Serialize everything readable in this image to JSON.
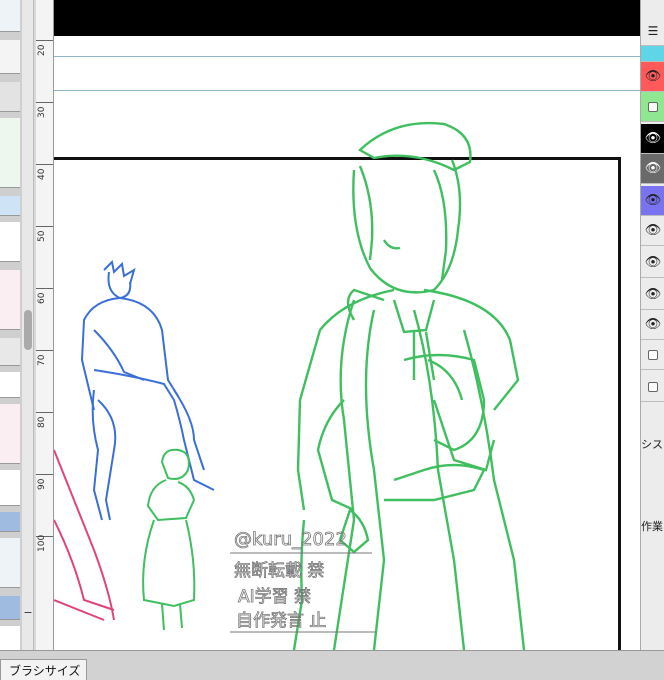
{
  "ruler": {
    "ticks": [
      "20",
      "30",
      "40",
      "50",
      "60",
      "70",
      "80",
      "90",
      "100"
    ]
  },
  "canvas": {
    "watermark_lines": [
      "@kuru_2022",
      "無断転載 禁",
      "AI学習 禁",
      "自作発言 止"
    ]
  },
  "layers_panel": {
    "rows": [
      {
        "type": "icon",
        "icon": "layer-list-icon",
        "color": "#ececec"
      },
      {
        "type": "empty",
        "color": "#5fd6e8"
      },
      {
        "type": "eye",
        "icon": "eye-icon",
        "color": "#ff5a5a"
      },
      {
        "type": "check",
        "icon": "checkbox",
        "color": "#8fe88f"
      },
      {
        "type": "eye",
        "icon": "eye-icon",
        "color": "#000000"
      },
      {
        "type": "eye",
        "icon": "eye-icon",
        "color": "#6a6a6a"
      },
      {
        "type": "eye",
        "icon": "eye-icon",
        "color": "#7a73f0"
      },
      {
        "type": "eye",
        "icon": "eye-icon",
        "color": "#ececec"
      },
      {
        "type": "eye",
        "icon": "eye-icon",
        "color": "#ececec"
      },
      {
        "type": "eye",
        "icon": "eye-icon",
        "color": "#ececec"
      },
      {
        "type": "eye",
        "icon": "eye-icon",
        "color": "#ececec"
      },
      {
        "type": "check",
        "icon": "checkbox",
        "color": "#ececec"
      },
      {
        "type": "check",
        "icon": "checkbox",
        "color": "#ececec"
      }
    ],
    "system_label": "シス",
    "work_label": "作業"
  },
  "side_controls": {
    "minus": "−"
  },
  "bottom_tab": {
    "label": "ブラシサイズ"
  },
  "colors": {
    "sketch_green": "#3fbf5f",
    "sketch_blue": "#3a6fd8",
    "sketch_pink": "#e0457a",
    "guide": "#8fb9c6"
  }
}
